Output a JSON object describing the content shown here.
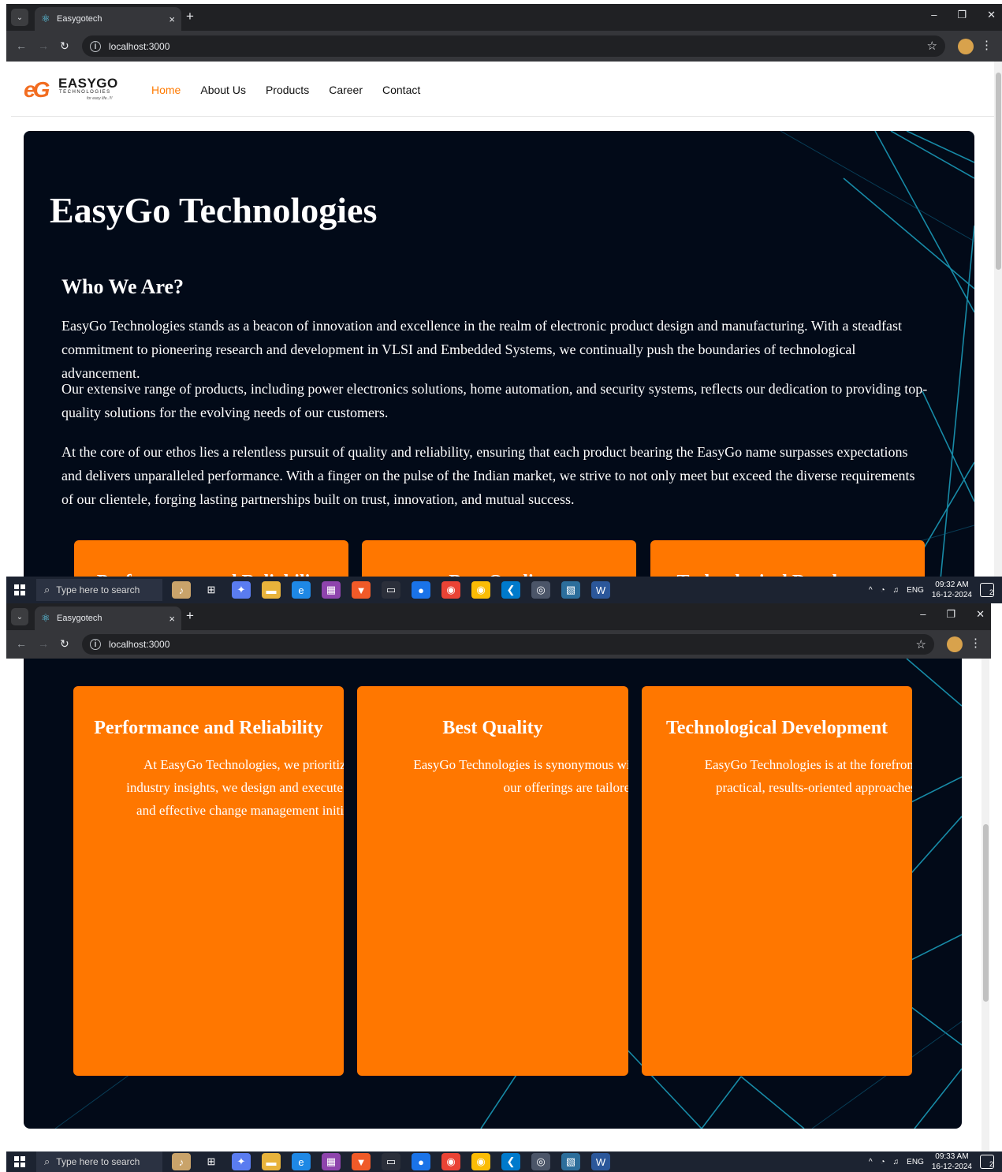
{
  "browser": {
    "tab_title": "Easygotech",
    "url": "localhost:3000",
    "new_tab_symbol": "+",
    "tab_close_symbol": "×",
    "window_controls": [
      "–",
      "❐",
      "✕"
    ]
  },
  "site": {
    "logo": {
      "word": "EASYGO",
      "sub": "TECHNOLOGIES",
      "tagline": "for easy life..!!!"
    },
    "nav": [
      {
        "label": "Home",
        "active": true
      },
      {
        "label": "About Us"
      },
      {
        "label": "Products"
      },
      {
        "label": "Career"
      },
      {
        "label": "Contact"
      }
    ]
  },
  "about": {
    "title": "EasyGo Technologies",
    "subtitle": "Who We Are?",
    "paragraphs": [
      "EasyGo Technologies stands as a beacon of innovation and excellence in the realm of electronic product design and manufacturing. With a steadfast commitment to pioneering research and development in VLSI and Embedded Systems, we continually push the boundaries of technological advancement.",
      "Our extensive range of products, including power electronics solutions, home automation, and security systems, reflects our dedication to providing top-quality solutions for the evolving needs of our customers.",
      "At the core of our ethos lies a relentless pursuit of quality and reliability, ensuring that each product bearing the EasyGo name surpasses expectations and delivers unparalleled performance. With a finger on the pulse of the Indian market, we strive to not only meet but exceed the diverse requirements of our clientele, forging lasting partnerships built on trust, innovation, and mutual success."
    ]
  },
  "cards": [
    {
      "title": "Performance and Reliability",
      "text": "At EasyGo Technologies, we prioritize performance and reliability in every aspect of our operations. Leveraging cutting-edge research, analytics, and industry insights, we design and execute critical programs that drive business-driven HR strategies, innovative talent development, leadership enhancement, and effective change management initiatives. Our goal is to ensure that our solutions not only meet but exceed the expectations of our clients, delivering tangible results and sustainable outcomes."
    },
    {
      "title": "Best Quality",
      "text": "EasyGo Technologies is synonymous with best quality in electronic product design and manufacturing. Compliant with industry regulations and standards, our offerings are tailored to suit the diverse needs of the Indian market, both in commercial and residential environments."
    },
    {
      "title": "Technological Development",
      "text": "EasyGo Technologies is at the forefront of technological development, delivering solutions that drive transformation, improve productivity. We focus on practical, results-oriented approaches, linking our solutions to measurable goals to ensure our clients' success. With a commitment to innovation, we continuously push boundaries."
    }
  ],
  "taskbar": {
    "search_placeholder": "Type here to search",
    "language": "ENG",
    "notification_count": "2",
    "shot1": {
      "time": "09:32 AM",
      "date": "16-12-2024"
    },
    "shot2": {
      "time": "09:33 AM",
      "date": "16-12-2024"
    }
  },
  "colors": {
    "accent": "#ff7700",
    "hero_bg": "#020a18",
    "nav_active": "#ff7a00",
    "chrome_dark": "#202124"
  },
  "icons": [
    "chrome-tab-menu-icon",
    "react-favicon-icon",
    "back-arrow-icon",
    "forward-arrow-icon",
    "reload-icon",
    "site-info-icon",
    "bookmark-star-icon",
    "profile-avatar-icon",
    "kebab-menu-icon",
    "windows-start-icon",
    "search-icon"
  ]
}
